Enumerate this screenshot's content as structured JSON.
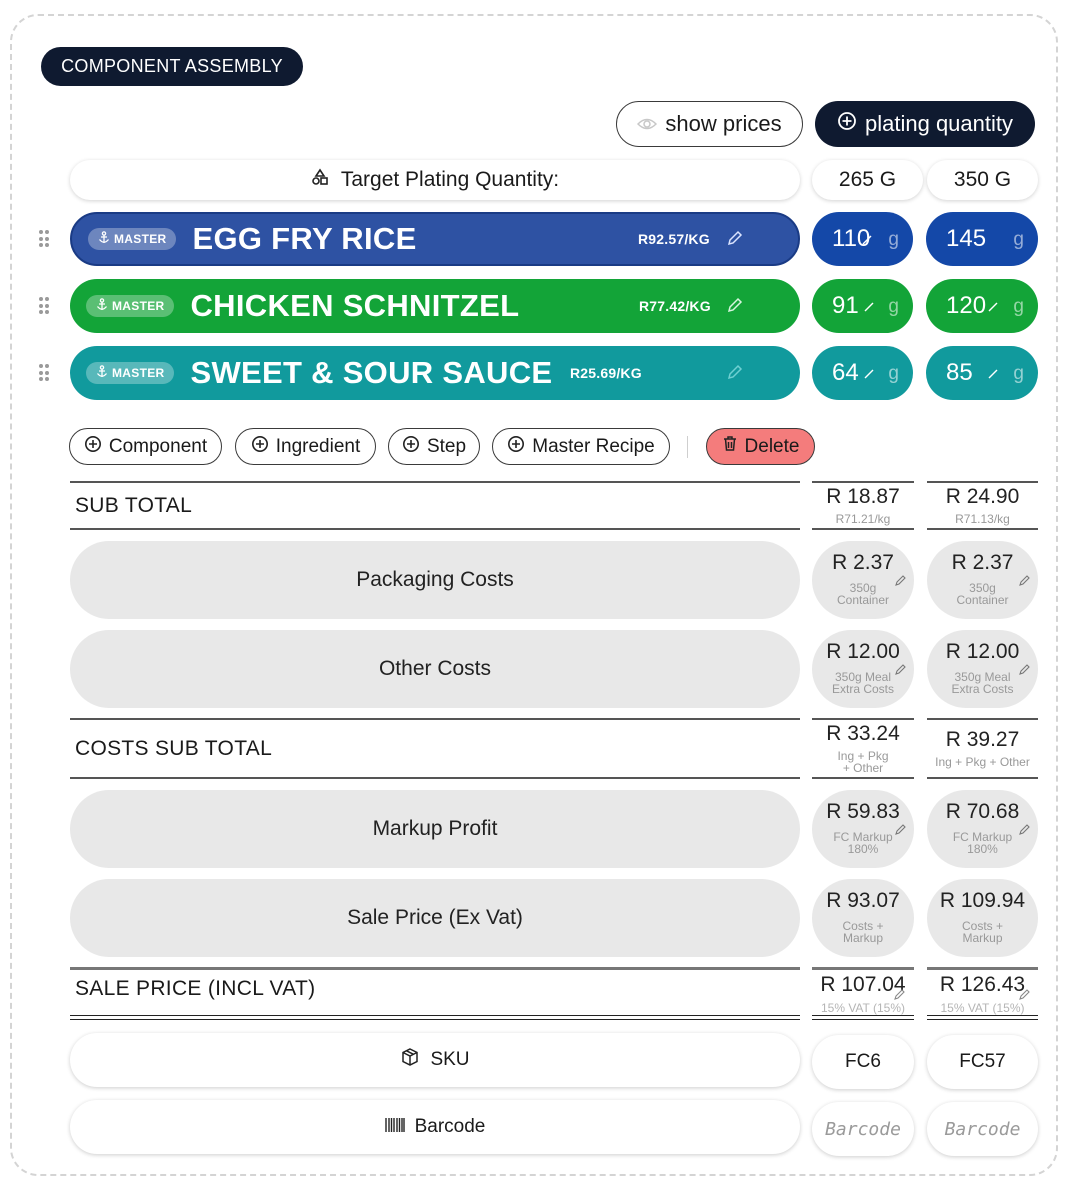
{
  "header": {
    "title": "COMPONENT ASSEMBLY"
  },
  "toolbar": {
    "show_prices": "show prices",
    "plating_quantity": "plating quantity"
  },
  "target": {
    "label": "Target Plating Quantity:",
    "qty1": "265 G",
    "qty2": "350 G"
  },
  "components": [
    {
      "badge": "MASTER",
      "name": "EGG FRY RICE",
      "price": "R92.57/KG",
      "g1": "110",
      "g2": "145",
      "unit": "g",
      "color": "#2e52a3",
      "g_color": "#1448a8"
    },
    {
      "badge": "MASTER",
      "name": "CHICKEN SCHNITZEL",
      "price": "R77.42/KG",
      "g1": "91",
      "g2": "120",
      "unit": "g",
      "color": "#13a438",
      "g_color": "#13a438"
    },
    {
      "badge": "MASTER",
      "name": "SWEET & SOUR SAUCE",
      "price": "R25.69/KG",
      "g1": "64",
      "g2": "85",
      "unit": "g",
      "color": "#119a9d",
      "g_color": "#119a9d"
    }
  ],
  "actions": {
    "component": "Component",
    "ingredient": "Ingredient",
    "step": "Step",
    "master_recipe": "Master Recipe",
    "delete": "Delete"
  },
  "subtotal": {
    "label": "SUB TOTAL",
    "v1": "R 18.87",
    "s1": "R71.21/kg",
    "v2": "R 24.90",
    "s2": "R71.13/kg"
  },
  "packaging": {
    "label": "Packaging Costs",
    "v1": "R 2.37",
    "s1a": "350g",
    "s1b": "Container",
    "v2": "R 2.37",
    "s2a": "350g",
    "s2b": "Container"
  },
  "other": {
    "label": "Other Costs",
    "v1": "R 12.00",
    "s1a": "350g Meal",
    "s1b": "Extra Costs",
    "v2": "R 12.00",
    "s2a": "350g Meal",
    "s2b": "Extra Costs"
  },
  "costs_subtotal": {
    "label": "COSTS SUB TOTAL",
    "v1": "R 33.24",
    "s1a": "Ing + Pkg",
    "s1b": "+ Other",
    "v2": "R 39.27",
    "s2": "Ing + Pkg + Other"
  },
  "markup": {
    "label": "Markup Profit",
    "v1": "R 59.83",
    "s1a": "FC Markup",
    "s1b": "180%",
    "v2": "R 70.68",
    "s2a": "FC Markup",
    "s2b": "180%"
  },
  "sale_ex": {
    "label": "Sale Price (Ex Vat)",
    "v1": "R 93.07",
    "s1a": "Costs +",
    "s1b": "Markup",
    "v2": "R 109.94",
    "s2a": "Costs +",
    "s2b": "Markup"
  },
  "sale_incl": {
    "label": "SALE PRICE (INCL VAT)",
    "v1": "R 107.04",
    "s1": "15% VAT (15%)",
    "v2": "R 126.43",
    "s2": "15% VAT (15%)"
  },
  "sku": {
    "label": "SKU",
    "v1": "FC6",
    "v2": "FC57"
  },
  "barcode": {
    "label": "Barcode",
    "ph1": "Barcode",
    "ph2": "Barcode"
  },
  "icons": [
    "eye-icon",
    "plus-circle-icon",
    "shapes-icon",
    "drag-handle-icon",
    "anchor-icon",
    "pencil-icon",
    "trash-icon",
    "box-icon",
    "barcode-icon"
  ]
}
